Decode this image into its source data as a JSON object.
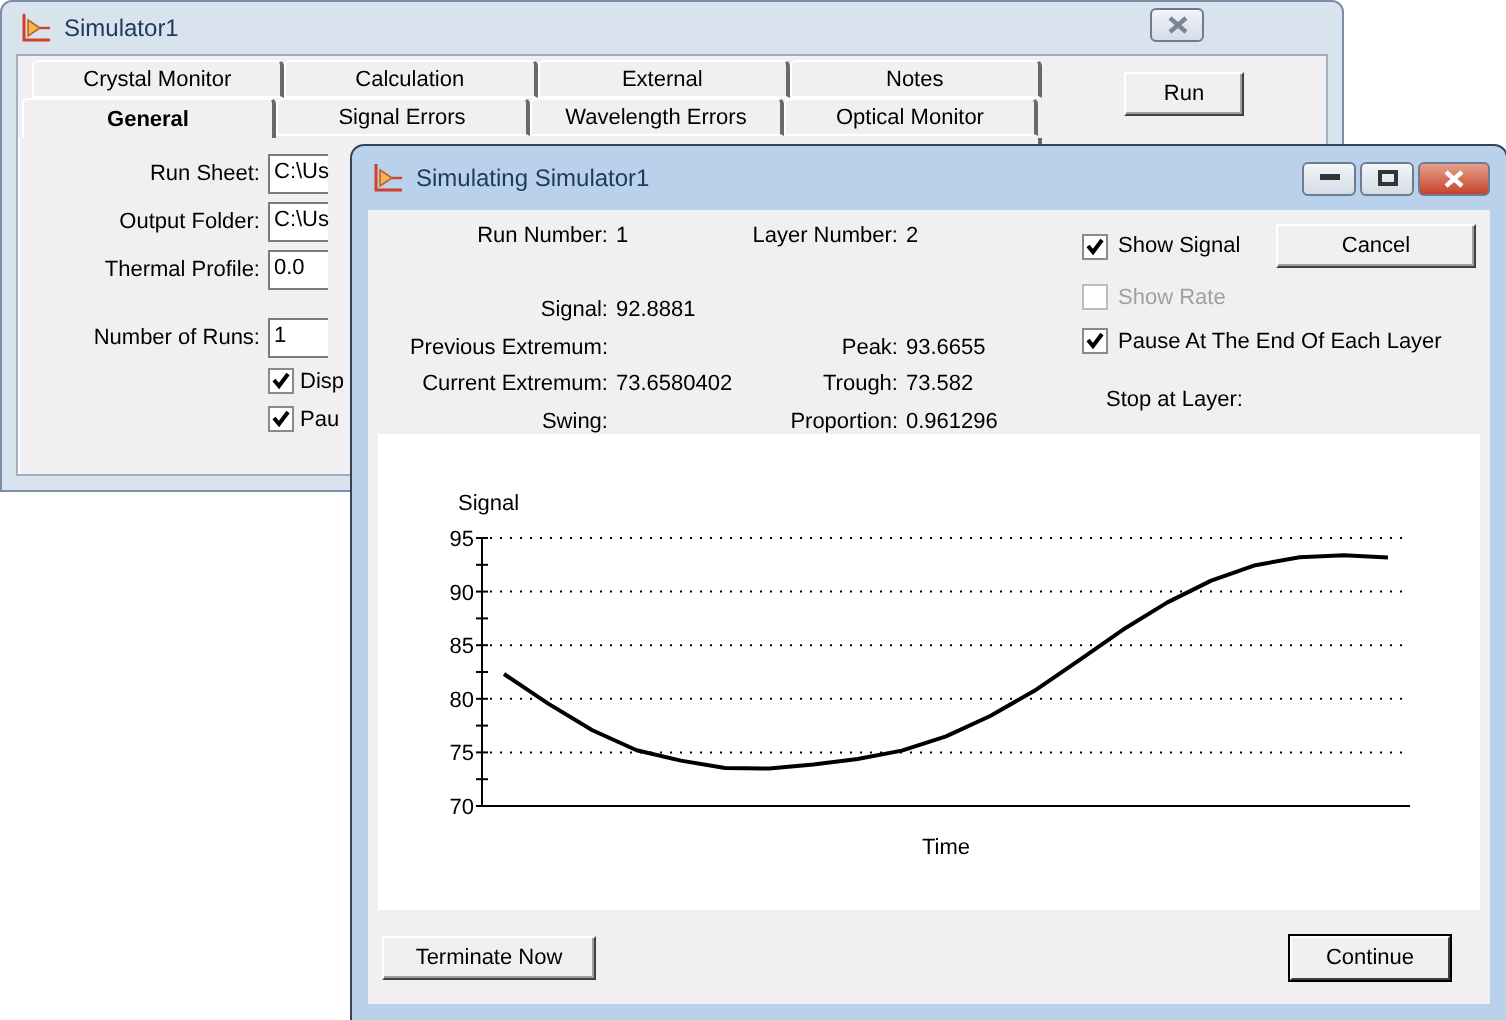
{
  "main_window": {
    "title": "Simulator1",
    "tabs_back": [
      {
        "label": "Crystal Monitor",
        "selected": false
      },
      {
        "label": "Calculation",
        "selected": false
      },
      {
        "label": "External",
        "selected": false
      },
      {
        "label": "Notes",
        "selected": false
      }
    ],
    "tabs_front": [
      {
        "label": "General",
        "selected": true
      },
      {
        "label": "Signal Errors",
        "selected": false
      },
      {
        "label": "Wavelength Errors",
        "selected": false
      },
      {
        "label": "Optical Monitor",
        "selected": false
      }
    ],
    "run_button": {
      "label": "Run"
    },
    "fields": [
      {
        "label": "Run Sheet:",
        "value": "C:\\Us"
      },
      {
        "label": "Output Folder:",
        "value": "C:\\Us"
      },
      {
        "label": "Thermal Profile:",
        "value": "0.0"
      },
      {
        "label": "Number of Runs:",
        "value": "1"
      }
    ],
    "checkboxes": [
      {
        "label": "Disp",
        "checked": true
      },
      {
        "label": "Pau",
        "checked": true
      }
    ]
  },
  "dialog": {
    "title": "Simulating Simulator1",
    "info_rows": [
      {
        "left": {
          "label": "Run Number:",
          "value": "1"
        },
        "right": {
          "label": "Layer Number:",
          "value": "2"
        }
      },
      {
        "left": {
          "label": "Signal:",
          "value": "92.8881"
        }
      },
      {
        "left": {
          "label": "Previous Extremum:"
        },
        "right": {
          "label": "Peak:",
          "value": "93.6655"
        }
      },
      {
        "left": {
          "label": "Current Extremum:",
          "value": "73.6580402"
        },
        "right": {
          "label": "Trough:",
          "value": "73.582"
        }
      },
      {
        "left": {
          "label": "Swing:"
        },
        "right": {
          "label": "Proportion:",
          "value": "0.961296"
        }
      }
    ],
    "options": [
      {
        "label": "Show Signal",
        "checked": true,
        "disabled": false
      },
      {
        "label": "Show Rate",
        "checked": false,
        "disabled": true
      },
      {
        "label": "Pause At The End Of Each Layer",
        "checked": true,
        "disabled": false
      }
    ],
    "stop_label": "Stop at Layer:",
    "cancel_button": {
      "label": "Cancel"
    },
    "chart_data": {
      "type": "line",
      "ylabel": "Signal",
      "xlabel": "Time",
      "grid": true,
      "ylim": [
        70,
        95
      ],
      "yticks": [
        70,
        75,
        80,
        85,
        90,
        95
      ],
      "series": [
        {
          "color": "#000000",
          "values": [
            82.32,
            79.56,
            77.07,
            75.2,
            74.24,
            73.55,
            73.48,
            73.87,
            74.38,
            75.17,
            76.5,
            78.4,
            80.75,
            83.57,
            86.43,
            88.98,
            91.02,
            92.47,
            93.21,
            93.4,
            93.19
          ]
        }
      ]
    },
    "terminate_button": {
      "label": "Terminate Now"
    },
    "continue_button": {
      "label": "Continue"
    }
  }
}
